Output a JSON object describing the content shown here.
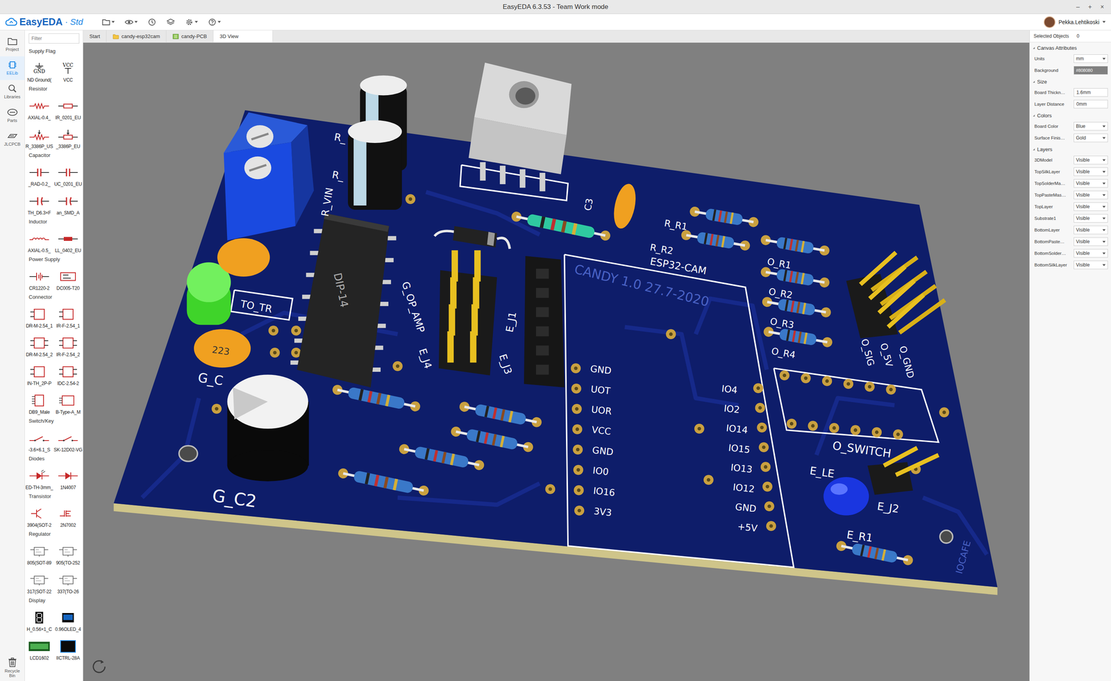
{
  "window": {
    "title": "EasyEDA 6.3.53 - Team Work mode",
    "controls": [
      "–",
      "+",
      "×"
    ]
  },
  "toolbar": {
    "logo": "EasyEDA",
    "separator": "·",
    "edition": "Std",
    "user": "Pekka.Lehtikoski"
  },
  "rail": {
    "items": [
      {
        "label": "Project",
        "selected": false
      },
      {
        "label": "EELib",
        "selected": true
      },
      {
        "label": "Libraries",
        "selected": false
      },
      {
        "label": "Parts",
        "selected": false
      },
      {
        "label": "JLCPCB",
        "selected": false
      }
    ],
    "bottom": {
      "label": "Recycle Bin"
    }
  },
  "library": {
    "placeholder": "Filter",
    "sections": [
      {
        "title": "Supply Flag",
        "items": [
          {
            "label": "ND Ground(",
            "kind": "ground",
            "symbol": "GND"
          },
          {
            "label": "VCC",
            "kind": "vcc",
            "symbol": "VCC"
          }
        ]
      },
      {
        "title": "Resistor",
        "items": [
          {
            "label": "AXIAL-0.4_",
            "kind": "resistor"
          },
          {
            "label": "IR_0201_EU",
            "kind": "resistor-box"
          },
          {
            "label": "R_3386P_US",
            "kind": "pot"
          },
          {
            "label": "_3386P_EU",
            "kind": "pot-box"
          }
        ]
      },
      {
        "title": "Capacitor",
        "items": [
          {
            "label": "_RAD-0.2_",
            "kind": "capacitor"
          },
          {
            "label": "UC_0201_EU",
            "kind": "capacitor"
          },
          {
            "label": "TH_D6.3×F",
            "kind": "capacitor-pol"
          },
          {
            "label": "an_SMD_A",
            "kind": "capacitor-pol"
          }
        ]
      },
      {
        "title": "Inductor",
        "items": [
          {
            "label": "AXIAL-0.5_",
            "kind": "inductor"
          },
          {
            "label": "LL_0402_EU",
            "kind": "inductor-box"
          }
        ]
      },
      {
        "title": "Power Supply",
        "items": [
          {
            "label": "CR1220-2",
            "kind": "battery"
          },
          {
            "label": "DC005-T20",
            "kind": "jack"
          }
        ]
      },
      {
        "title": "Connector",
        "items": [
          {
            "label": "DR-M-2.54_1",
            "kind": "header"
          },
          {
            "label": "IR-F-2.54_1",
            "kind": "header"
          },
          {
            "label": "DR-M-2.54_2",
            "kind": "header2"
          },
          {
            "label": "IR-F-2.54_2",
            "kind": "header2"
          },
          {
            "label": "IN-TH_2P-P",
            "kind": "header"
          },
          {
            "label": "IDC-2.54-2",
            "kind": "header2"
          },
          {
            "label": "DB9_Male",
            "kind": "db9"
          },
          {
            "label": "B-Type-A_M",
            "kind": "usb"
          }
        ]
      },
      {
        "title": "Switch/Key",
        "items": [
          {
            "label": "-3.6×6.1_S",
            "kind": "switch"
          },
          {
            "label": "SK-12D02-VG",
            "kind": "switch"
          }
        ]
      },
      {
        "title": "Diodes",
        "items": [
          {
            "label": "ED-TH-3mm_",
            "kind": "led"
          },
          {
            "label": "1N4007",
            "kind": "diode"
          }
        ]
      },
      {
        "title": "Transistor",
        "items": [
          {
            "label": "3904(SOT-2",
            "kind": "bjt"
          },
          {
            "label": "2N7002",
            "kind": "mosfet"
          }
        ]
      },
      {
        "title": "Regulator",
        "items": [
          {
            "label": "805(SOT-89",
            "kind": "regulator"
          },
          {
            "label": "905(TO-252",
            "kind": "regulator"
          },
          {
            "label": "317(SOT-22",
            "kind": "regulator"
          },
          {
            "label": "337(TO-26",
            "kind": "regulator"
          }
        ]
      },
      {
        "title": "Display",
        "items": [
          {
            "label": "H_0.56×1_C",
            "kind": "seg7"
          },
          {
            "label": "0.96OLED_4",
            "kind": "oled"
          },
          {
            "label": "LCD1602",
            "kind": "lcd"
          },
          {
            "label": "IICTRL-28A",
            "kind": "tft"
          }
        ]
      }
    ]
  },
  "tabs": [
    {
      "label": "Start",
      "kind": "plain",
      "selected": false
    },
    {
      "label": "candy-esp32cam",
      "kind": "schematic",
      "selected": false
    },
    {
      "label": "candy-PCB",
      "kind": "pcb",
      "selected": false
    },
    {
      "label": "3D View",
      "kind": "plain",
      "selected": true
    }
  ],
  "pcb": {
    "labels": [
      {
        "text": "R_",
        "kind": "silk"
      },
      {
        "text": "R_",
        "kind": "silk"
      },
      {
        "text": "R_VIN",
        "kind": "silk"
      },
      {
        "text": "TO_TR",
        "kind": "silk"
      },
      {
        "text": "G_C",
        "kind": "silk"
      },
      {
        "text": "G_C2",
        "kind": "silk"
      },
      {
        "text": "DIP-14",
        "kind": "chip"
      },
      {
        "text": "223",
        "kind": "cap"
      },
      {
        "text": "G_OP_AMP",
        "kind": "silk"
      },
      {
        "text": "E_J4",
        "kind": "silk"
      },
      {
        "text": "E_J3",
        "kind": "silk"
      },
      {
        "text": "E_J1",
        "kind": "silk"
      },
      {
        "text": "C3",
        "kind": "silk"
      },
      {
        "text": "R_R1",
        "kind": "silk"
      },
      {
        "text": "R_R2",
        "kind": "silk"
      },
      {
        "text": "ESP32-CAM",
        "kind": "silk"
      },
      {
        "text": "CANDY 1.0 27.7-2020",
        "kind": "copper"
      },
      {
        "text": "O_R1",
        "kind": "silk"
      },
      {
        "text": "O_R2",
        "kind": "silk"
      },
      {
        "text": "O_R3",
        "kind": "silk"
      },
      {
        "text": "O_R4",
        "kind": "silk"
      },
      {
        "text": "O_SIG",
        "kind": "silk"
      },
      {
        "text": "O_5V",
        "kind": "silk"
      },
      {
        "text": "O_GND",
        "kind": "silk"
      },
      {
        "text": "GND",
        "kind": "silk"
      },
      {
        "text": "UOT",
        "kind": "silk"
      },
      {
        "text": "UOR",
        "kind": "silk"
      },
      {
        "text": "VCC",
        "kind": "silk"
      },
      {
        "text": "GND",
        "kind": "silk"
      },
      {
        "text": "IO0",
        "kind": "silk"
      },
      {
        "text": "IO16",
        "kind": "silk"
      },
      {
        "text": "3V3",
        "kind": "silk"
      },
      {
        "text": "IO4",
        "kind": "silk"
      },
      {
        "text": "IO2",
        "kind": "silk"
      },
      {
        "text": "IO14",
        "kind": "silk"
      },
      {
        "text": "IO15",
        "kind": "silk"
      },
      {
        "text": "IO13",
        "kind": "silk"
      },
      {
        "text": "IO12",
        "kind": "silk"
      },
      {
        "text": "GND",
        "kind": "silk"
      },
      {
        "text": "+5V",
        "kind": "silk"
      },
      {
        "text": "O_SWITCH",
        "kind": "silk"
      },
      {
        "text": "E_LE",
        "kind": "silk"
      },
      {
        "text": "E_J2",
        "kind": "silk"
      },
      {
        "text": "E_R1",
        "kind": "silk"
      },
      {
        "text": "IOCAFE",
        "kind": "copper"
      }
    ]
  },
  "properties": {
    "header": {
      "label": "Selected Objects",
      "count": "0"
    },
    "sections": [
      {
        "title": "Canvas Attributes",
        "rows": [
          {
            "label": "Units",
            "value": "mm",
            "kind": "select"
          },
          {
            "label": "Background",
            "value": "#808080",
            "kind": "color"
          }
        ]
      },
      {
        "title": "Size",
        "rows": [
          {
            "label": "Board Thickn…",
            "value": "1.6mm",
            "kind": "input"
          },
          {
            "label": "Layer Distance",
            "value": "0mm",
            "kind": "input"
          }
        ]
      },
      {
        "title": "Colors",
        "rows": [
          {
            "label": "Board Color",
            "value": "Blue",
            "kind": "select"
          },
          {
            "label": "Surface Finis…",
            "value": "Gold",
            "kind": "select"
          }
        ]
      },
      {
        "title": "Layers",
        "rows": [
          {
            "label": "3DModel",
            "value": "Visible",
            "kind": "select"
          },
          {
            "label": "TopSilkLayer",
            "value": "Visible",
            "kind": "select"
          },
          {
            "label": "TopSolderMa…",
            "value": "Visible",
            "kind": "select"
          },
          {
            "label": "TopPasteMas…",
            "value": "Visible",
            "kind": "select"
          },
          {
            "label": "TopLayer",
            "value": "Visible",
            "kind": "select"
          },
          {
            "label": "Substrate1",
            "value": "Visible",
            "kind": "select"
          },
          {
            "label": "BottomLayer",
            "value": "Visible",
            "kind": "select"
          },
          {
            "label": "BottomPaste…",
            "value": "Visible",
            "kind": "select"
          },
          {
            "label": "BottomSolder…",
            "value": "Visible",
            "kind": "select"
          },
          {
            "label": "BottomSilkLayer",
            "value": "Visible",
            "kind": "select"
          }
        ]
      }
    ]
  }
}
